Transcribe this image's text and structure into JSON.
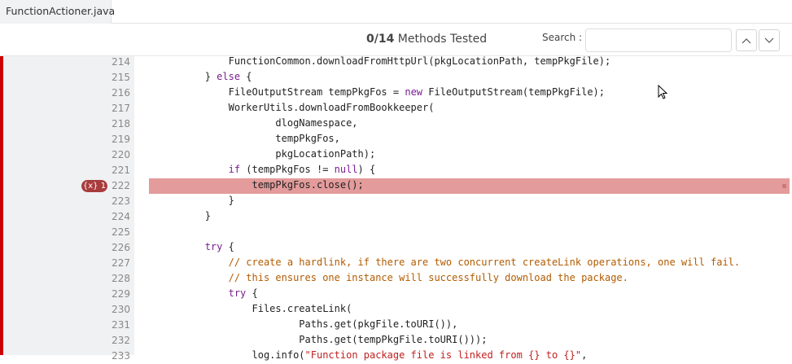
{
  "tab": {
    "label": "FunctionActioner.java"
  },
  "header": {
    "tested_count": "0/14",
    "tested_label": "Methods Tested",
    "search_label": "Search :",
    "search_value": "",
    "search_placeholder": ""
  },
  "badge": {
    "label": "{x} 1"
  },
  "colors": {
    "covered_bar": "#cc0000",
    "highlight": "#e39b9b",
    "badge": "#a83c3c",
    "keyword": "#7a1e90",
    "comment": "#b25b00"
  },
  "lines": [
    {
      "n": "214",
      "code": "                FunctionCommon.downloadFromHttpUrl(pkgLocationPath, tempPkgFile);"
    },
    {
      "n": "215",
      "code": "            } else {"
    },
    {
      "n": "216",
      "code": "                FileOutputStream tempPkgFos = new FileOutputStream(tempPkgFile);"
    },
    {
      "n": "217",
      "code": "                WorkerUtils.downloadFromBookkeeper("
    },
    {
      "n": "218",
      "code": "                        dlogNamespace,"
    },
    {
      "n": "219",
      "code": "                        tempPkgFos,"
    },
    {
      "n": "220",
      "code": "                        pkgLocationPath);"
    },
    {
      "n": "221",
      "code": "                if (tempPkgFos != null) {"
    },
    {
      "n": "222",
      "code": "                    tempPkgFos.close();"
    },
    {
      "n": "223",
      "code": "                }"
    },
    {
      "n": "224",
      "code": "            }"
    },
    {
      "n": "225",
      "code": ""
    },
    {
      "n": "226",
      "code": "            try {"
    },
    {
      "n": "227",
      "code": "                // create a hardlink, if there are two concurrent createLink operations, one will fail."
    },
    {
      "n": "228",
      "code": "                // this ensures one instance will successfully download the package."
    },
    {
      "n": "229",
      "code": "                try {"
    },
    {
      "n": "230",
      "code": "                    Files.createLink("
    },
    {
      "n": "231",
      "code": "                            Paths.get(pkgFile.toURI()),"
    },
    {
      "n": "232",
      "code": "                            Paths.get(tempPkgFile.toURI()));"
    },
    {
      "n": "233",
      "code": "                    log.info(\"Function package file is linked from {} to {}\","
    }
  ]
}
